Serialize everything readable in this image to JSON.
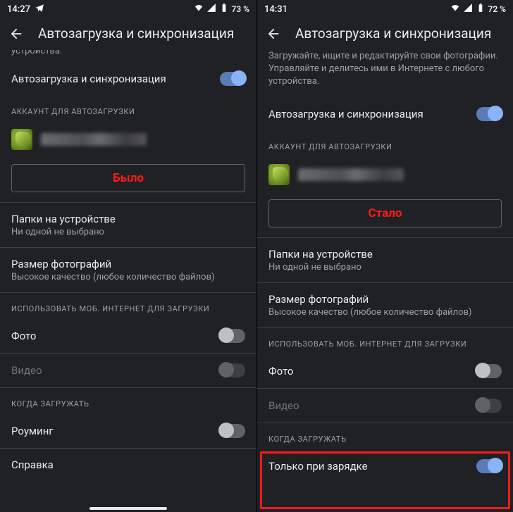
{
  "left": {
    "status": {
      "time": "14:27",
      "battery": "73 %"
    },
    "title": "Автозагрузка и синхронизация",
    "desc_cut": "устройства.",
    "main_toggle": "Автозагрузка и синхронизация",
    "acct_header": "АККАУНТ ДЛЯ АВТОЗАГРУЗКИ",
    "btn_label": "Было",
    "folders": {
      "title": "Папки на устройстве",
      "sub": "Ни одной не выбрано"
    },
    "size": {
      "title": "Размер фотографий",
      "sub": "Высокое качество (любое количество файлов)"
    },
    "mobile_header": "ИСПОЛЬЗОВАТЬ МОБ. ИНТЕРНЕТ ДЛЯ ЗАГРУЗКИ",
    "photo": "Фото",
    "video": "Видео",
    "when_header": "КОГДА ЗАГРУЖАТЬ",
    "roaming": "Роуминг",
    "help": "Справка"
  },
  "right": {
    "status": {
      "time": "14:31",
      "battery": "72 %"
    },
    "title": "Автозагрузка и синхронизация",
    "desc": "Загружайте, ищите и редактируйте свои фотографии. Управляйте и делитесь ими в Интернете с любого устройства.",
    "main_toggle": "Автозагрузка и синхронизация",
    "acct_header": "АККАУНТ ДЛЯ АВТОЗАГРУЗКИ",
    "btn_label": "Стало",
    "folders": {
      "title": "Папки на устройстве",
      "sub": "Ни одной не выбрано"
    },
    "size": {
      "title": "Размер фотографий",
      "sub": "Высокое качество (любое количество файлов)"
    },
    "mobile_header": "ИСПОЛЬЗОВАТЬ МОБ. ИНТЕРНЕТ ДЛЯ ЗАГРУЗКИ",
    "photo": "Фото",
    "video": "Видео",
    "when_header": "КОГДА ЗАГРУЖАТЬ",
    "charging": "Только при зарядке"
  }
}
